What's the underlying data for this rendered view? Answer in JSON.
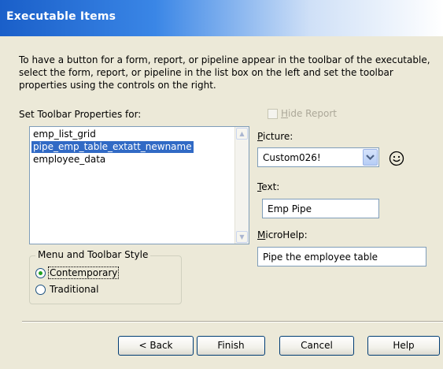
{
  "window": {
    "title": "Executable Items"
  },
  "description": "To have a button for a form, report, or pipeline appear in the toolbar of the executable, select the form, report, or pipeline in the list box on the left and set the toolbar properties using the controls on the right.",
  "list": {
    "label": "Set Toolbar Properties for:",
    "items": [
      "emp_list_grid",
      "pipe_emp_table_extatt_newname",
      "employee_data"
    ],
    "selected_index": 1
  },
  "style_group": {
    "legend": "Menu and Toolbar Style",
    "options": [
      "Contemporary",
      "Traditional"
    ],
    "selected": "Contemporary"
  },
  "hide_report": {
    "label": "Hide Report",
    "checked": false,
    "enabled": false
  },
  "picture": {
    "label": "Picture:",
    "value": "Custom026!",
    "icon": "smiley-icon"
  },
  "text_field": {
    "label": "Text:",
    "value": "Emp Pipe"
  },
  "microhelp": {
    "label": "MicroHelp:",
    "value": "Pipe the employee table"
  },
  "buttons": {
    "back": "< Back",
    "finish": "Finish",
    "cancel": "Cancel",
    "help": "Help"
  },
  "colors": {
    "selection": "#316AC5",
    "dialog_bg": "#ECE9D8",
    "title_text": "#ffffff"
  }
}
